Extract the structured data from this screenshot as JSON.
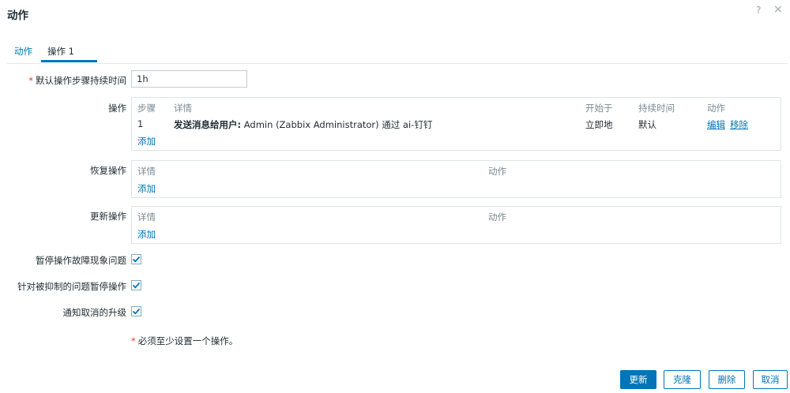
{
  "dialog": {
    "title": "动作",
    "help": "?",
    "close": "×"
  },
  "tabs": [
    {
      "label": "动作",
      "active": false
    },
    {
      "label": "操作",
      "count": "1",
      "active": true
    }
  ],
  "form": {
    "default_step_duration": {
      "label": "默认操作步骤持续时间",
      "value": "1h",
      "required": true
    },
    "operations": {
      "label": "操作",
      "columns": [
        "步骤",
        "详情",
        "开始于",
        "持续时间",
        "动作"
      ],
      "rows": [
        {
          "step": "1",
          "detail_bold": "发送消息给用户:",
          "detail_rest": " Admin (Zabbix Administrator) 通过 ai-钉钉",
          "start": "立即地",
          "duration": "默认",
          "edit": "编辑",
          "remove": "移除"
        }
      ],
      "add": "添加"
    },
    "recovery_operations": {
      "label": "恢复操作",
      "columns": [
        "详情",
        "动作"
      ],
      "add": "添加"
    },
    "update_operations": {
      "label": "更新操作",
      "columns": [
        "详情",
        "动作"
      ],
      "add": "添加"
    },
    "pause_problem": {
      "label": "暂停操作故障现象问题",
      "checked": true
    },
    "pause_suppressed": {
      "label": "针对被抑制的问题暂停操作",
      "checked": true
    },
    "notify_cancelled": {
      "label": "通知取消的升级",
      "checked": true
    },
    "required_note": "必须至少设置一个操作。",
    "required_mark": "*"
  },
  "footer": {
    "update": "更新",
    "clone": "克隆",
    "delete": "删除",
    "cancel": "取消"
  },
  "colors": {
    "accent": "#0275b8",
    "required": "#e53935"
  }
}
